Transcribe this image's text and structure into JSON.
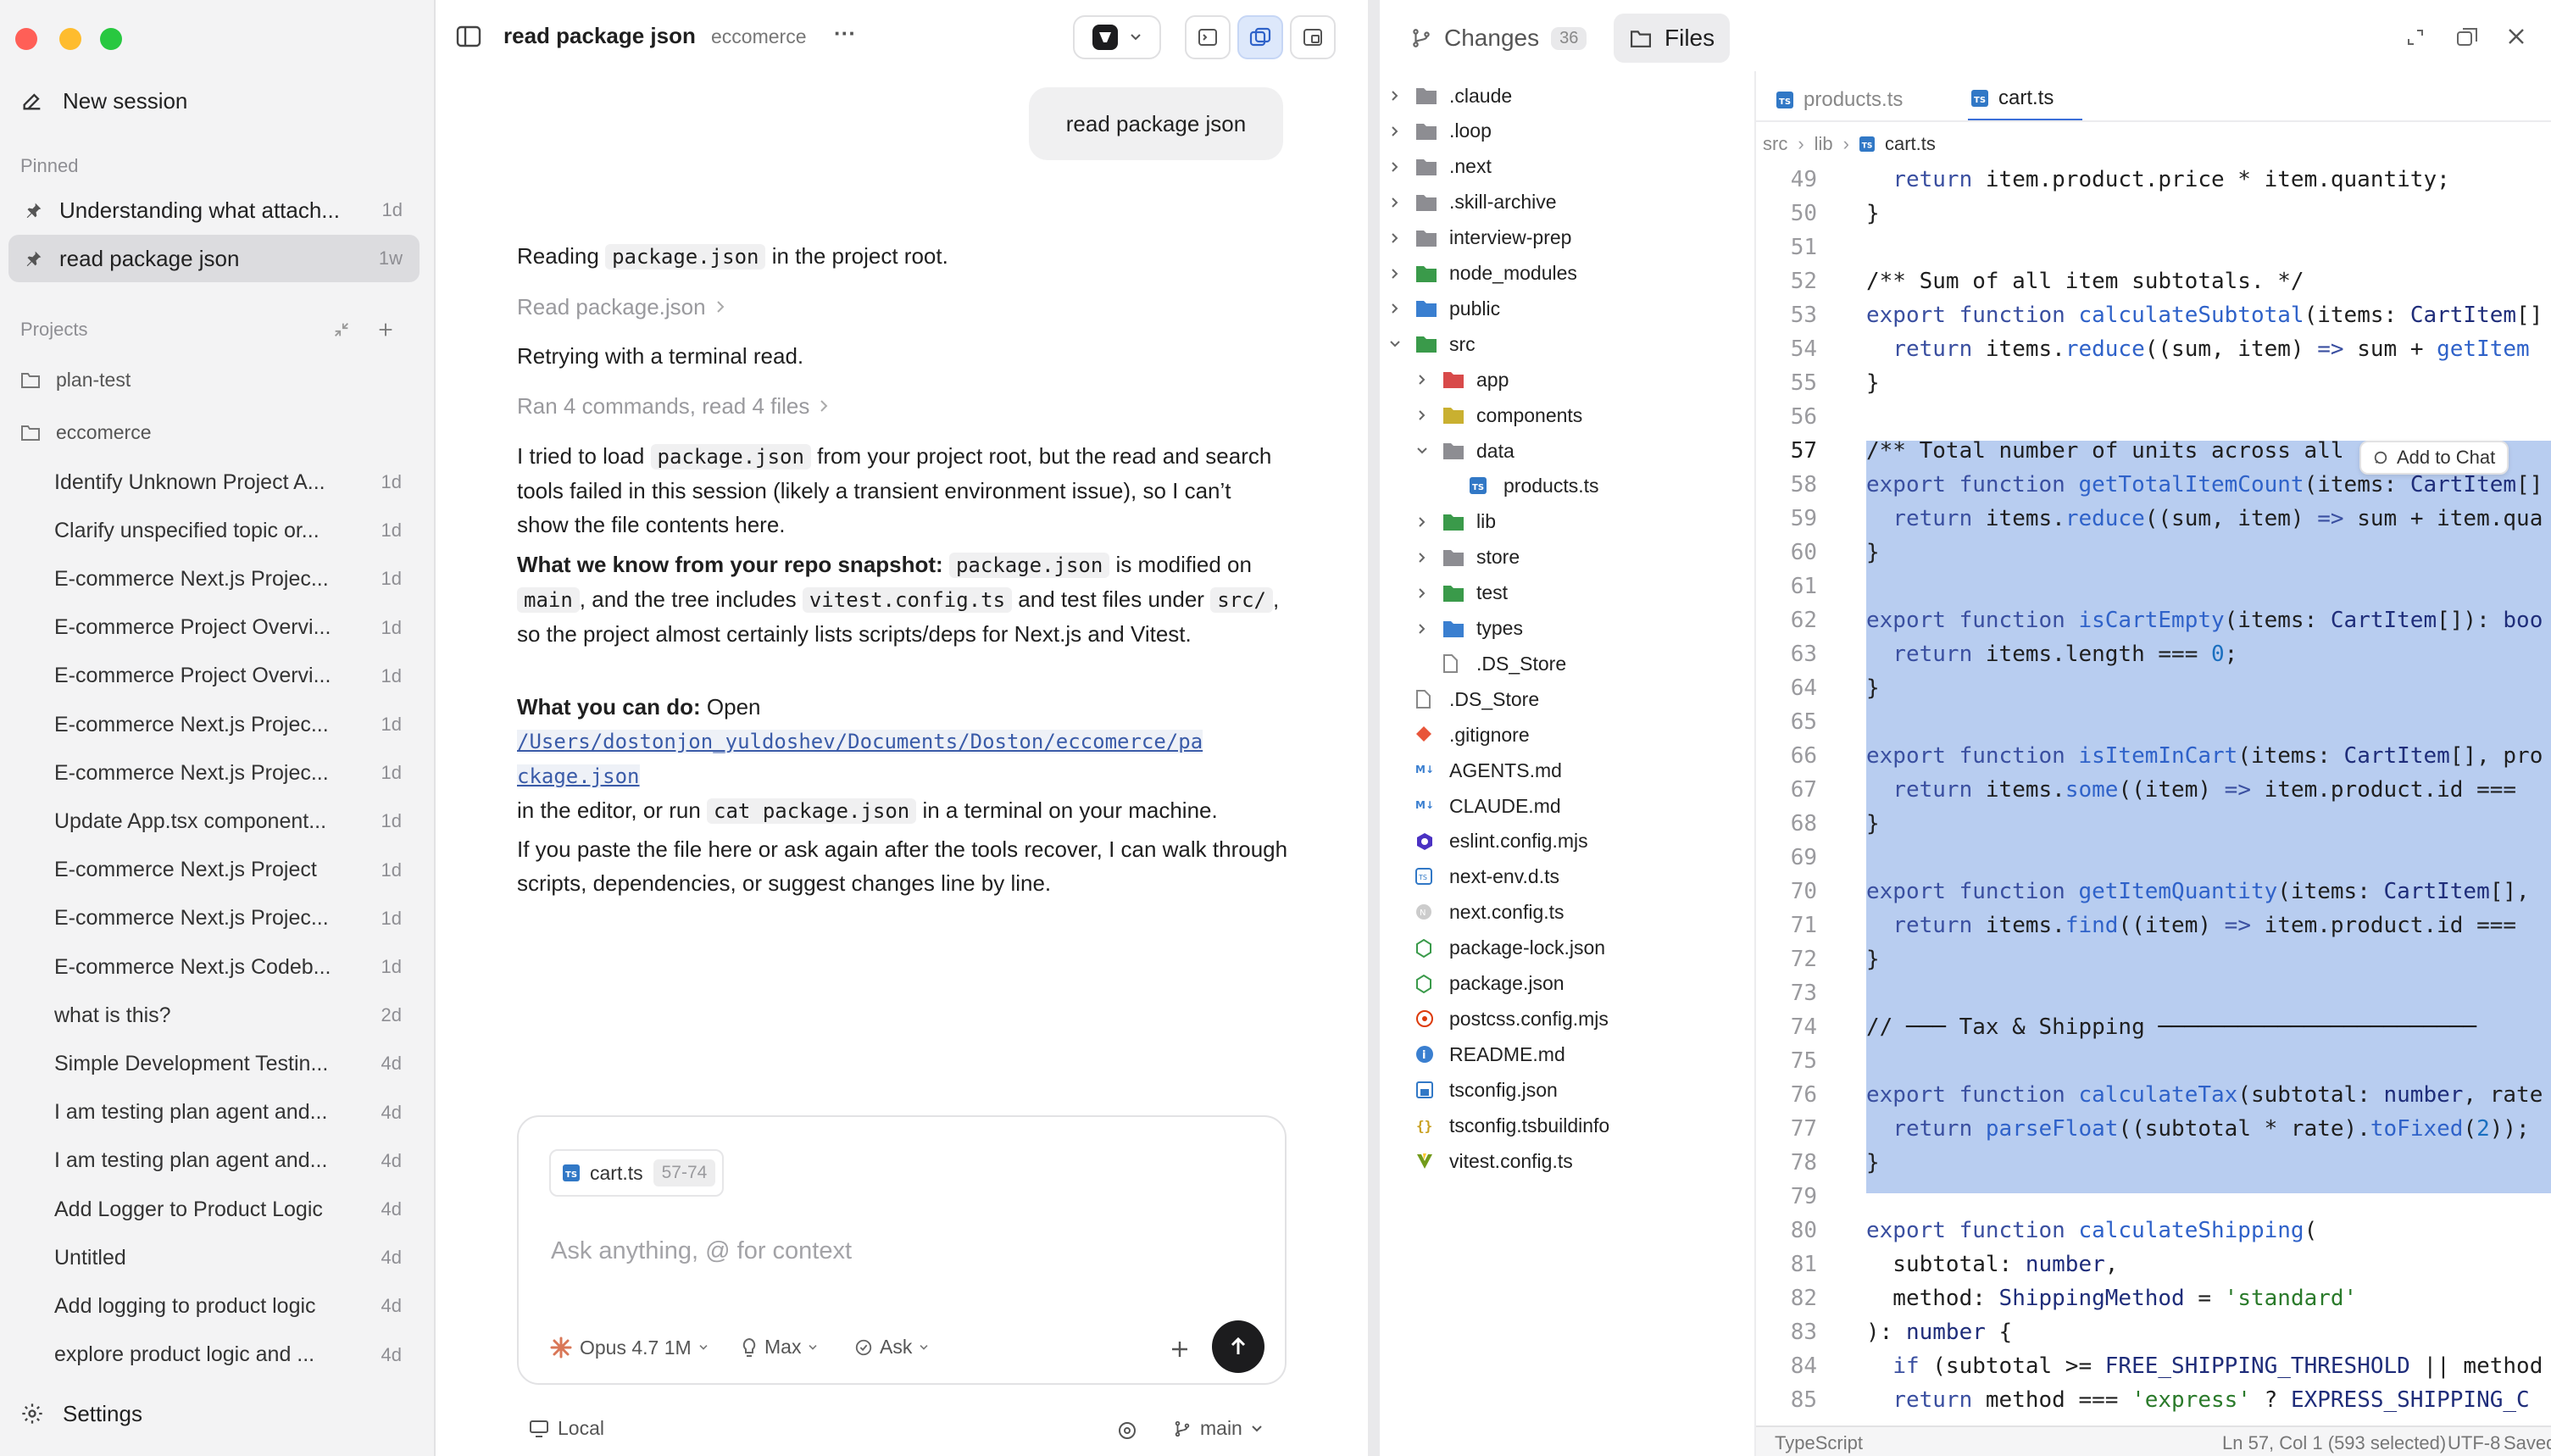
{
  "sidebar": {
    "new_session": "New session",
    "pinned_heading": "Pinned",
    "pinned": [
      {
        "title": "Understanding what attach...",
        "age": "1d"
      },
      {
        "title": "read package json",
        "age": "1w"
      }
    ],
    "projects_heading": "Projects",
    "projects": [
      {
        "name": "plan-test"
      },
      {
        "name": "eccomerce"
      }
    ],
    "sessions": [
      {
        "title": "Identify Unknown Project A...",
        "age": "1d"
      },
      {
        "title": "Clarify unspecified topic or...",
        "age": "1d"
      },
      {
        "title": "E-commerce Next.js Projec...",
        "age": "1d"
      },
      {
        "title": "E-commerce Project Overvi...",
        "age": "1d"
      },
      {
        "title": "E-commerce Project Overvi...",
        "age": "1d"
      },
      {
        "title": "E-commerce Next.js Projec...",
        "age": "1d"
      },
      {
        "title": "E-commerce Next.js Projec...",
        "age": "1d"
      },
      {
        "title": "Update App.tsx component...",
        "age": "1d"
      },
      {
        "title": "E-commerce Next.js Project",
        "age": "1d"
      },
      {
        "title": "E-commerce Next.js Projec...",
        "age": "1d"
      },
      {
        "title": "E-commerce Next.js Codeb...",
        "age": "1d"
      },
      {
        "title": "what is this?",
        "age": "2d"
      },
      {
        "title": "Simple Development Testin...",
        "age": "4d"
      },
      {
        "title": "I am testing plan agent and...",
        "age": "4d"
      },
      {
        "title": "I am testing plan agent and...",
        "age": "4d"
      },
      {
        "title": "Add Logger to Product Logic",
        "age": "4d"
      },
      {
        "title": "Untitled",
        "age": "4d"
      },
      {
        "title": "Add logging to product logic",
        "age": "4d"
      },
      {
        "title": "explore product logic and ...",
        "age": "4d"
      }
    ],
    "settings": "Settings"
  },
  "chat": {
    "title": "read package json",
    "project": "eccomerce",
    "more": "···",
    "user_message": "read package json",
    "p1_pre": "Reading ",
    "p1_code": "package.json",
    "p1_post": " in the project root.",
    "tool1": "Read package.json",
    "p2": "Retrying with a terminal read.",
    "tool2": "Ran 4 commands, read 4 files",
    "p3_a": "I tried to load ",
    "p3_code": "package.json",
    "p3_b": " from your project root, but the read and search tools failed in this session (likely a transient environment issue), so I can’t show the file contents here.",
    "p4_bold": "What we know from your repo snapshot:",
    "p4_code1": "package.json",
    "p4_a": " is modified on ",
    "p4_code2": "main",
    "p4_b": ", and the tree includes ",
    "p4_code3": "vitest.config.ts",
    "p4_c": " and test files under ",
    "p4_code4": "src/",
    "p4_d": ", so the project almost certainly lists scripts/deps for Next.js and Vitest.",
    "p5_bold": "What you can do:",
    "p5_a": " Open ",
    "p5_link_1": "/Users/dostonjon_yuldoshev/Documents/Doston/eccomerce/pa",
    "p5_link_2": "ckage.json",
    "p5_b": "in the editor, or run ",
    "p5_code": "cat package.json",
    "p5_c": " in a terminal on your machine.",
    "p6": "If you paste the file here or ask again after the tools recover, I can walk through scripts, dependencies, or suggest changes line by line.",
    "composer": {
      "chip_file": "cart.ts",
      "chip_range": "57-74",
      "placeholder": "Ask anything, @ for context",
      "model": "Opus 4.7 1M",
      "effort": "Max",
      "mode": "Ask"
    },
    "footer": {
      "location": "Local",
      "branch": "main"
    }
  },
  "right": {
    "tab_changes": "Changes",
    "changes_count": "36",
    "tab_files": "Files",
    "tree": [
      {
        "name": ".claude",
        "kind": "folder",
        "depth": 0,
        "open": false
      },
      {
        "name": ".loop",
        "kind": "folder",
        "depth": 0,
        "open": false
      },
      {
        "name": ".next",
        "kind": "folder",
        "depth": 0,
        "open": false
      },
      {
        "name": ".skill-archive",
        "kind": "folder",
        "depth": 0,
        "open": false
      },
      {
        "name": "interview-prep",
        "kind": "folder",
        "depth": 0,
        "open": false
      },
      {
        "name": "node_modules",
        "kind": "folder-green",
        "depth": 0,
        "open": false
      },
      {
        "name": "public",
        "kind": "folder-blue",
        "depth": 0,
        "open": false
      },
      {
        "name": "src",
        "kind": "folder-green",
        "depth": 0,
        "open": true
      },
      {
        "name": "app",
        "kind": "folder-red",
        "depth": 1,
        "open": false
      },
      {
        "name": "components",
        "kind": "folder-yellow",
        "depth": 1,
        "open": false
      },
      {
        "name": "data",
        "kind": "folder",
        "depth": 1,
        "open": true
      },
      {
        "name": "products.ts",
        "kind": "ts",
        "depth": 2,
        "open": null
      },
      {
        "name": "lib",
        "kind": "folder-green",
        "depth": 1,
        "open": false
      },
      {
        "name": "store",
        "kind": "folder",
        "depth": 1,
        "open": false
      },
      {
        "name": "test",
        "kind": "folder-green",
        "depth": 1,
        "open": false
      },
      {
        "name": "types",
        "kind": "folder-blue",
        "depth": 1,
        "open": false
      },
      {
        "name": ".DS_Store",
        "kind": "file",
        "depth": 1,
        "open": null
      },
      {
        "name": ".DS_Store",
        "kind": "file",
        "depth": 0,
        "open": null
      },
      {
        "name": ".gitignore",
        "kind": "git",
        "depth": 0,
        "open": null
      },
      {
        "name": "AGENTS.md",
        "kind": "md",
        "depth": 0,
        "open": null
      },
      {
        "name": "CLAUDE.md",
        "kind": "md",
        "depth": 0,
        "open": null
      },
      {
        "name": "eslint.config.mjs",
        "kind": "eslint",
        "depth": 0,
        "open": null
      },
      {
        "name": "next-env.d.ts",
        "kind": "dts",
        "depth": 0,
        "open": null
      },
      {
        "name": "next.config.ts",
        "kind": "next",
        "depth": 0,
        "open": null
      },
      {
        "name": "package-lock.json",
        "kind": "npm",
        "depth": 0,
        "open": null
      },
      {
        "name": "package.json",
        "kind": "npm",
        "depth": 0,
        "open": null
      },
      {
        "name": "postcss.config.mjs",
        "kind": "postcss",
        "depth": 0,
        "open": null
      },
      {
        "name": "README.md",
        "kind": "info",
        "depth": 0,
        "open": null
      },
      {
        "name": "tsconfig.json",
        "kind": "tsconfig",
        "depth": 0,
        "open": null
      },
      {
        "name": "tsconfig.tsbuildinfo",
        "kind": "json",
        "depth": 0,
        "open": null
      },
      {
        "name": "vitest.config.ts",
        "kind": "vitest",
        "depth": 0,
        "open": null
      }
    ],
    "editor_tabs": [
      {
        "name": "products.ts",
        "active": false
      },
      {
        "name": "cart.ts",
        "active": true
      }
    ],
    "breadcrumb": [
      "src",
      "lib",
      "cart.ts"
    ],
    "add_to_chat": "Add to Chat",
    "status": {
      "language": "TypeScript",
      "position": "Ln 57, Col 1 (593 selected)",
      "encoding": "UTF-8",
      "saved": "Saved"
    }
  }
}
